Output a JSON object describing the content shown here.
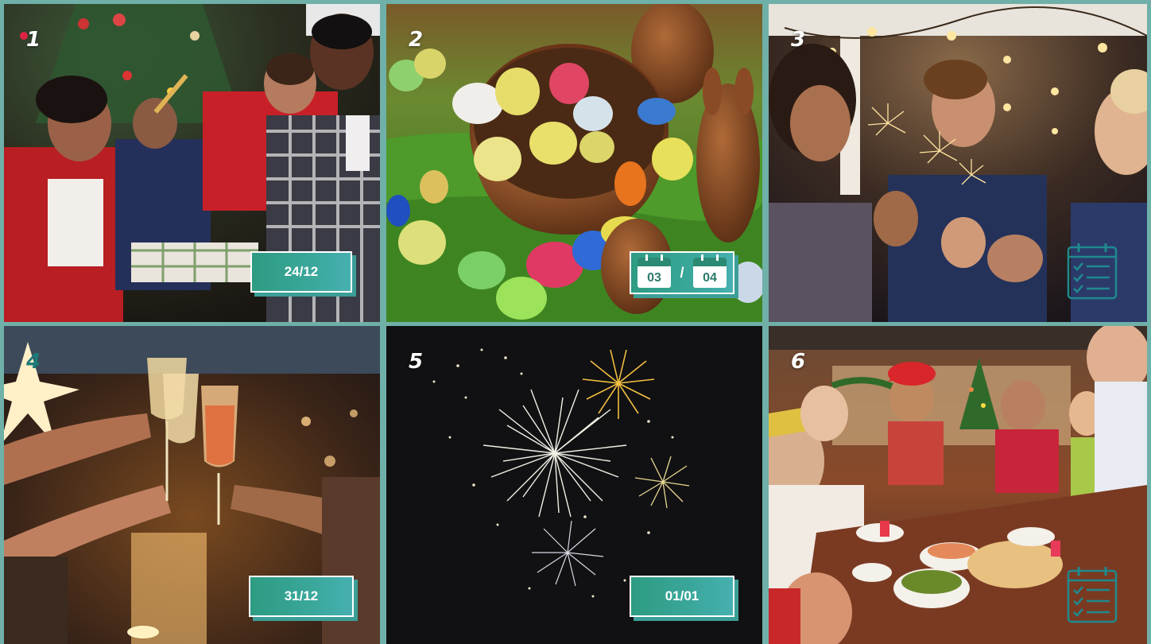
{
  "tiles": [
    {
      "number": "1",
      "date": "24/12"
    },
    {
      "number": "2",
      "date_start": "03",
      "date_separator": "/",
      "date_end": "04"
    },
    {
      "number": "3",
      "icon": "checklist-calendar-icon"
    },
    {
      "number": "4",
      "date": "31/12"
    },
    {
      "number": "5",
      "date": "01/01"
    },
    {
      "number": "6",
      "icon": "checklist-calendar-icon"
    }
  ],
  "colors": {
    "divider": "#6fb0a8",
    "badge_start": "#2e9b82",
    "badge_end": "#47b0b0",
    "number_teal": "#1d7a78"
  }
}
